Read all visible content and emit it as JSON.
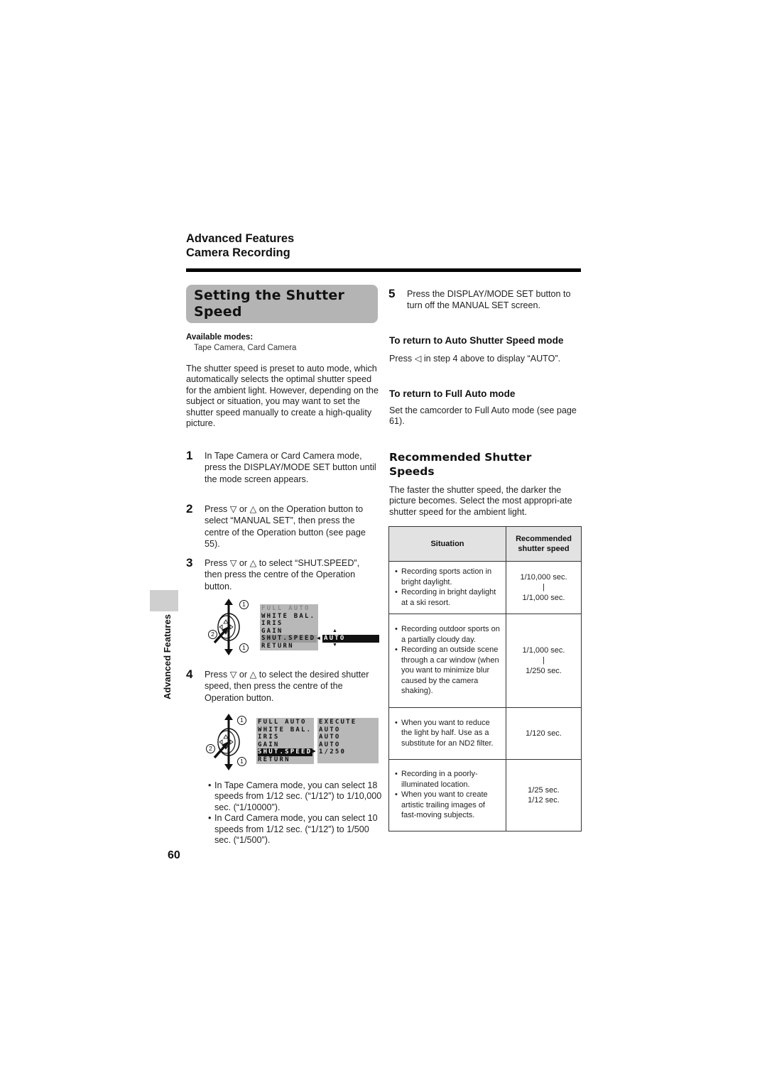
{
  "header": {
    "section": "Advanced Features",
    "subsection": "Camera Recording"
  },
  "title": {
    "line1": "Setting the Shutter",
    "line2": "Speed"
  },
  "available_modes": {
    "label": "Available modes:",
    "value": "Tape Camera, Card Camera"
  },
  "intro": "The shutter speed is preset to auto mode, which automatically selects the optimal shutter speed for the ambient light. However, depending on the subject or situation, you may want to set the shutter speed manually to create a high-quality picture.",
  "steps": [
    {
      "num": "1",
      "text": "In Tape Camera or Card Camera mode, press the DISPLAY/MODE SET button until the mode screen appears."
    },
    {
      "num": "2",
      "text": "Press ▽ or △ on the Operation button to select “MANUAL SET”, then press the centre of the Operation button (see page 55)."
    },
    {
      "num": "3",
      "text": "Press ▽ or △ to select “SHUT.SPEED”, then press the centre of the Operation button."
    },
    {
      "num": "4",
      "text": "Press ▽ or △ to select the desired shutter speed, then press the centre of the Operation button."
    },
    {
      "num": "5",
      "text": "Press the DISPLAY/MODE SET button to turn off the MANUAL SET screen."
    }
  ],
  "diagram1": {
    "callouts": [
      "1",
      "2",
      "1"
    ],
    "menu": [
      "FULL AUTO",
      "WHITE BAL.",
      "IRIS",
      "GAIN",
      "SHUT.SPEED",
      "RETURN"
    ],
    "selected": "SHUT.SPEED",
    "value": "AUTO",
    "up_arrow": "▲",
    "down_arrow": "▼",
    "pointer": "◀"
  },
  "diagram2": {
    "callouts": [
      "1",
      "2",
      "1"
    ],
    "menu": [
      "FULL AUTO",
      "WHITE BAL.",
      "IRIS",
      "GAIN",
      "SHUT.SPEED",
      "RETURN"
    ],
    "values": [
      "EXECUTE",
      "AUTO",
      "AUTO",
      "AUTO",
      "1/250"
    ],
    "selected": "SHUT.SPEED",
    "pointer": "▶"
  },
  "notes": [
    "In Tape Camera mode, you can select 18 speeds from 1/12 sec. (“1/12”) to 1/10,000 sec. (“1/10000”).",
    "In Card Camera mode, you can select 10 speeds from 1/12 sec. (“1/12”) to 1/500 sec. (“1/500”)."
  ],
  "return_auto": {
    "heading": "To return to Auto Shutter Speed mode",
    "text": "Press ◁ in step 4 above to display “AUTO”."
  },
  "return_full_auto": {
    "heading": "To return to Full Auto mode",
    "text": "Set the camcorder to Full Auto mode (see page 61)."
  },
  "recommended": {
    "heading_line1": "Recommended Shutter",
    "heading_line2": "Speeds",
    "text": "The faster the shutter speed, the darker the picture becomes. Select the most appropri-ate shutter speed for the ambient light.",
    "table": {
      "headers": [
        "Situation",
        "Recommended shutter speed"
      ],
      "rows": [
        {
          "situations": [
            "Recording sports action in bright daylight.",
            "Recording in bright daylight at a ski resort."
          ],
          "speeds": [
            "1/10,000 sec.",
            "|",
            "1/1,000 sec."
          ]
        },
        {
          "situations": [
            "Recording outdoor sports on a partially cloudy day.",
            "Recording an outside scene through a car window (when you want to minimize blur caused by the camera shaking)."
          ],
          "speeds": [
            "1/1,000 sec.",
            "|",
            "1/250 sec."
          ]
        },
        {
          "situations": [
            "When you want to reduce the light by half. Use as a substitute for an ND2 filter."
          ],
          "speeds": [
            "1/120 sec."
          ]
        },
        {
          "situations": [
            "Recording in a poorly-illuminated location.",
            "When you want to create artistic trailing images of fast-moving subjects."
          ],
          "speeds": [
            "1/25 sec.",
            "1/12 sec."
          ]
        }
      ]
    }
  },
  "side_tab": "Advanced Features",
  "page_number": "60"
}
